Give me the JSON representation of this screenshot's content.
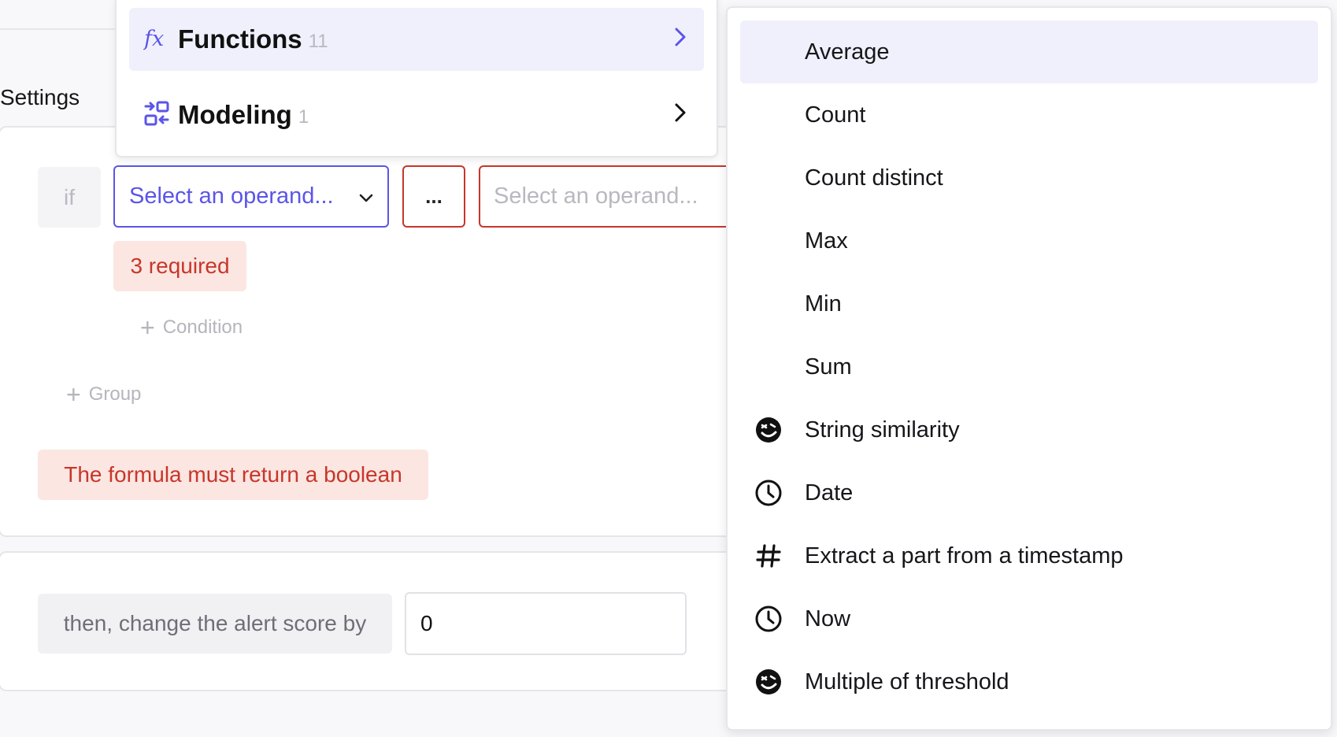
{
  "page": {
    "settings_label": "Settings"
  },
  "condition": {
    "if_label": "if",
    "operand_left_placeholder": "Select an operand...",
    "operator_label": "...",
    "operand_right_placeholder": "Select an operand...",
    "required_badge": "3 required",
    "add_condition_label": "Condition",
    "add_group_label": "Group",
    "formula_error": "The formula must return a boolean"
  },
  "then": {
    "label": "then, change the alert score by",
    "score_value": "0"
  },
  "category_menu": {
    "items": [
      {
        "label": "Functions",
        "count": "11",
        "icon": "function-icon"
      },
      {
        "label": "Modeling",
        "count": "1",
        "icon": "modeling-icon"
      }
    ]
  },
  "function_menu": {
    "items": [
      {
        "label": "Average",
        "icon": ""
      },
      {
        "label": "Count",
        "icon": ""
      },
      {
        "label": "Count distinct",
        "icon": ""
      },
      {
        "label": "Max",
        "icon": ""
      },
      {
        "label": "Min",
        "icon": ""
      },
      {
        "label": "Sum",
        "icon": ""
      },
      {
        "label": "String similarity",
        "icon": "emoji-face-icon"
      },
      {
        "label": "Date",
        "icon": "clock-icon"
      },
      {
        "label": "Extract a part from a timestamp",
        "icon": "hash-icon"
      },
      {
        "label": "Now",
        "icon": "clock-icon"
      },
      {
        "label": "Multiple of threshold",
        "icon": "emoji-face-icon"
      }
    ]
  },
  "colors": {
    "accent": "#5b55e8",
    "error": "#c8362a",
    "error_bg": "#fbe6e2",
    "menu_highlight": "#f0f0fc"
  }
}
